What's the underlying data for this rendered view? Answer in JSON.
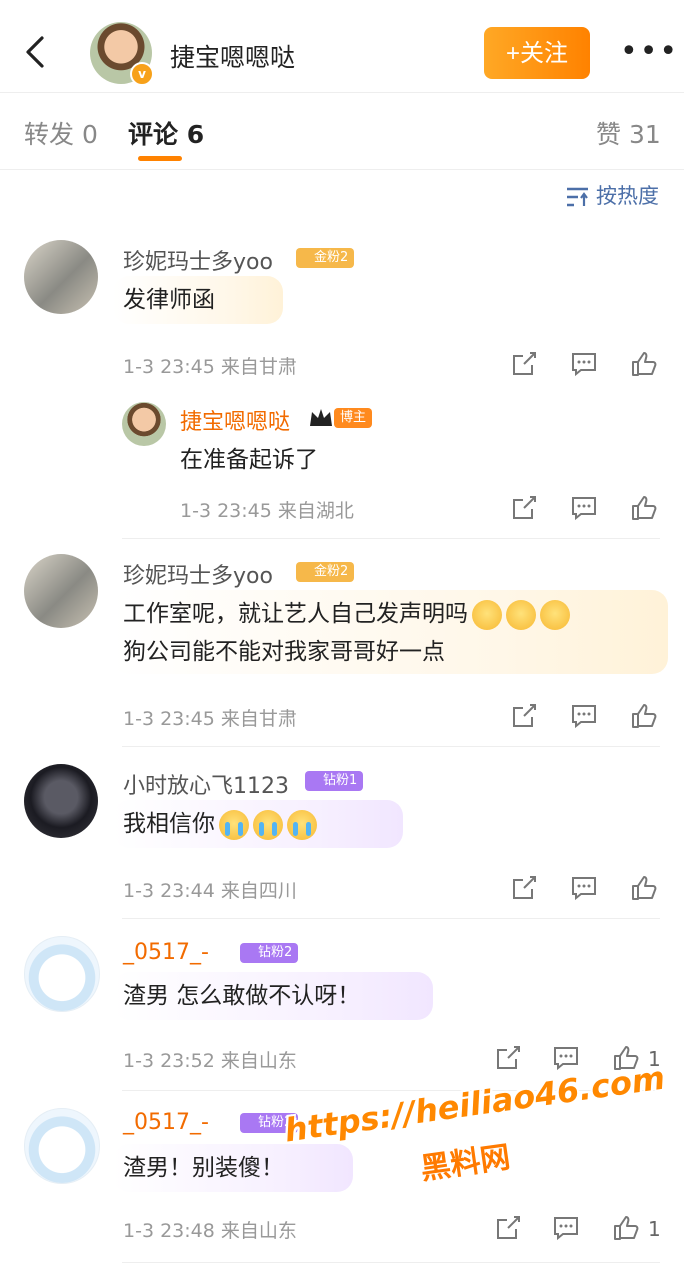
{
  "header": {
    "name": "捷宝嗯嗯哒",
    "follow_label": "+关注",
    "more_label": "•••"
  },
  "tabs": {
    "repost": "转发 0",
    "comments": "评论 6",
    "likes": "赞 31"
  },
  "sort_label": "按热度",
  "comments": [
    {
      "user": "珍妮玛士多yoo",
      "badge": "金粉2",
      "text": "发律师函",
      "meta": "1-3 23:45  来自甘肃"
    },
    {
      "user": "捷宝嗯嗯哒",
      "badge": "博主",
      "text": "在准备起诉了",
      "meta": "1-3 23:45  来自湖北"
    },
    {
      "user": "珍妮玛士多yoo",
      "badge": "金粉2",
      "text_line1": "工作室呢，就让艺人自己发声明吗",
      "text_line2": "狗公司能不能对我家哥哥好一点",
      "meta": "1-3 23:45  来自甘肃"
    },
    {
      "user": "小时放心飞1123",
      "badge": "钻粉1",
      "text": "我相信你",
      "meta": "1-3 23:44  来自四川"
    },
    {
      "user": "_0517_-",
      "badge": "钻粉2",
      "text": "渣男 怎么敢做不认呀！",
      "meta": "1-3 23:52  来自山东",
      "likes": "1"
    },
    {
      "user": "_0517_-",
      "badge": "钻粉2",
      "text": "渣男！别装傻！",
      "meta": "1-3 23:48  来自山东",
      "likes": "1"
    }
  ],
  "watermark": {
    "url": "https://heiliao46.com",
    "name": "黑料网"
  }
}
